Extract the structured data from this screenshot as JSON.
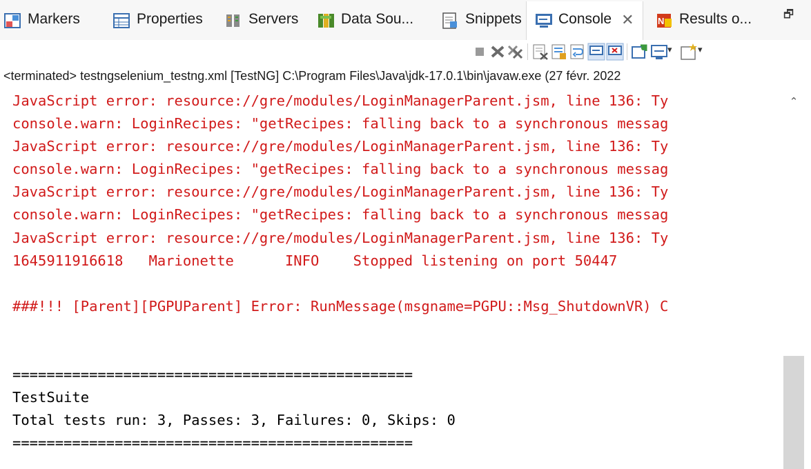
{
  "tabs": [
    {
      "label": "Markers",
      "icon": "markers-icon"
    },
    {
      "label": "Properties",
      "icon": "properties-icon"
    },
    {
      "label": "Servers",
      "icon": "servers-icon"
    },
    {
      "label": "Data Sou...",
      "icon": "data-source-icon"
    },
    {
      "label": "Snippets",
      "icon": "snippets-icon"
    },
    {
      "label": "Console",
      "icon": "console-icon",
      "active": true,
      "close": "✕"
    },
    {
      "label": "Results o...",
      "icon": "testng-results-icon"
    }
  ],
  "maximize_glyph": "🗗",
  "toolbar": {
    "buttons": [
      "terminate-icon",
      "remove-launch-icon",
      "remove-all-terminated-icon",
      "clear-console-icon",
      "scroll-lock-icon",
      "word-wrap-icon",
      "show-on-stdout-icon",
      "show-on-stderr-icon",
      "pin-console-icon",
      "display-selected-console-icon",
      "open-console-icon"
    ],
    "dropdown_glyph": "▾"
  },
  "status_line": "<terminated> testngselenium_testng.xml [TestNG] C:\\Program Files\\Java\\jdk-17.0.1\\bin\\javaw.exe  (27 févr. 2022",
  "console": {
    "lines": [
      {
        "text": "JavaScript error: resource://gre/modules/LoginManagerParent.jsm, line 136: Ty",
        "kind": "err"
      },
      {
        "text": "console.warn: LoginRecipes: \"getRecipes: falling back to a synchronous messag",
        "kind": "err"
      },
      {
        "text": "JavaScript error: resource://gre/modules/LoginManagerParent.jsm, line 136: Ty",
        "kind": "err"
      },
      {
        "text": "console.warn: LoginRecipes: \"getRecipes: falling back to a synchronous messag",
        "kind": "err"
      },
      {
        "text": "JavaScript error: resource://gre/modules/LoginManagerParent.jsm, line 136: Ty",
        "kind": "err"
      },
      {
        "text": "console.warn: LoginRecipes: \"getRecipes: falling back to a synchronous messag",
        "kind": "err"
      },
      {
        "text": "JavaScript error: resource://gre/modules/LoginManagerParent.jsm, line 136: Ty",
        "kind": "err"
      },
      {
        "text": "1645911916618   Marionette      INFO    Stopped listening on port 50447",
        "kind": "err"
      },
      {
        "text": "",
        "kind": "out"
      },
      {
        "text": "###!!! [Parent][PGPUParent] Error: RunMessage(msgname=PGPU::Msg_ShutdownVR) C",
        "kind": "err"
      },
      {
        "text": "",
        "kind": "out"
      },
      {
        "text": "",
        "kind": "out"
      },
      {
        "text": "===============================================",
        "kind": "out"
      },
      {
        "text": "TestSuite",
        "kind": "out"
      },
      {
        "text": "Total tests run: 3, Passes: 3, Failures: 0, Skips: 0",
        "kind": "out"
      },
      {
        "text": "===============================================",
        "kind": "out"
      }
    ]
  },
  "scrollbar": {
    "up_glyph": "⌃",
    "position": 1.0
  },
  "colors": {
    "error": "#d11a1a",
    "output": "#000000",
    "tabbar": "#f7f7f7"
  }
}
